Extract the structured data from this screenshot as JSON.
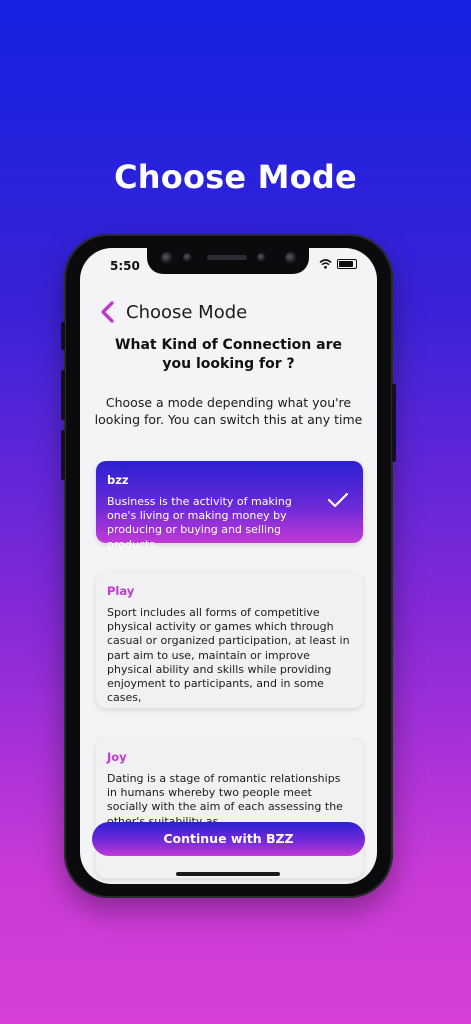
{
  "page": {
    "title": "Choose Mode"
  },
  "status_bar": {
    "time": "5:50"
  },
  "screen": {
    "header_title": "Choose Mode",
    "question": "What Kind of Connection are you looking for ?",
    "subtitle": "Choose a mode depending what you're looking for. You can switch this at any time"
  },
  "modes": [
    {
      "title": "bzz",
      "description": "Business is the activity of making one's living or making money by producing or buying and selling products.",
      "selected": true
    },
    {
      "title": "Play",
      "description": "Sport includes all forms of competitive physical activity or games which through casual or organized participation, at least in part aim to use, maintain or improve physical ability and skills while providing enjoyment to participants, and in some cases,",
      "selected": false
    },
    {
      "title": "Joy",
      "description": "Dating is a stage of romantic relationships in humans whereby two people meet socially with the aim of each assessing the other's suitability as",
      "selected": false
    }
  ],
  "continue_button": {
    "label": "Continue with BZZ"
  },
  "colors": {
    "accent": "#c03ad0",
    "gradient_top": "#1422e0",
    "gradient_bottom": "#d640d8"
  },
  "icons": {
    "back": "chevron-left-icon",
    "check": "checkmark-icon"
  }
}
